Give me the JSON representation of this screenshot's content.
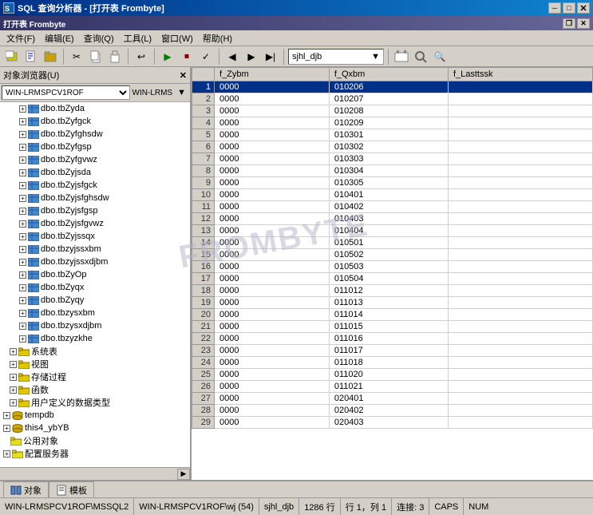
{
  "window": {
    "title": "SQL 查询分析器 - [打开表  Frombyte]",
    "icon": "SQL"
  },
  "titlebar": {
    "title": "SQL 查询分析器 - [打开表  Frombyte]",
    "minimize": "─",
    "maximize": "□",
    "restore": "❐",
    "close": "✕",
    "inner_restore": "❐",
    "inner_close": "✕"
  },
  "menubar": {
    "items": [
      {
        "label": "文件(F)"
      },
      {
        "label": "编辑(E)"
      },
      {
        "label": "查询(Q)"
      },
      {
        "label": "工具(L)"
      },
      {
        "label": "窗口(W)"
      },
      {
        "label": "帮助(H)"
      }
    ]
  },
  "toolbar": {
    "dropdown_value": "sjhl_djb",
    "buttons": [
      "⬅",
      "➡",
      "⊠",
      "📋",
      "✂",
      "📄",
      "📑",
      "⏸",
      "▶",
      "⏹",
      "⏸",
      "◀",
      "▶",
      "▶▶",
      "⏸"
    ]
  },
  "object_browser": {
    "header": "对象浏览器(U)",
    "server": "WIN-LRMSPCV1ROF",
    "connect_label": "WIN-LRMS",
    "tree_items": [
      {
        "indent": 20,
        "has_expand": true,
        "icon": "table",
        "label": "dbo.tbZyda",
        "level": 2
      },
      {
        "indent": 20,
        "has_expand": true,
        "icon": "table",
        "label": "dbo.tbZyfgck",
        "level": 2
      },
      {
        "indent": 20,
        "has_expand": true,
        "icon": "table",
        "label": "dbo.tbZyfghsdw",
        "level": 2
      },
      {
        "indent": 20,
        "has_expand": true,
        "icon": "table",
        "label": "dbo.tbZyfgsp",
        "level": 2
      },
      {
        "indent": 20,
        "has_expand": true,
        "icon": "table",
        "label": "dbo.tbZyfgvwz",
        "level": 2
      },
      {
        "indent": 20,
        "has_expand": true,
        "icon": "table",
        "label": "dbo.tbZyjsda",
        "level": 2
      },
      {
        "indent": 20,
        "has_expand": true,
        "icon": "table",
        "label": "dbo.tbZyjsfgck",
        "level": 2
      },
      {
        "indent": 20,
        "has_expand": true,
        "icon": "table",
        "label": "dbo.tbZyjsfghsdw",
        "level": 2
      },
      {
        "indent": 20,
        "has_expand": true,
        "icon": "table",
        "label": "dbo.tbZyjsfgsp",
        "level": 2
      },
      {
        "indent": 20,
        "has_expand": true,
        "icon": "table",
        "label": "dbo.tbZyjsfgvwz",
        "level": 2
      },
      {
        "indent": 20,
        "has_expand": true,
        "icon": "table",
        "label": "dbo.tbZyjssqx",
        "level": 2
      },
      {
        "indent": 20,
        "has_expand": true,
        "icon": "table",
        "label": "dbo.tbzyjssxbm",
        "level": 2
      },
      {
        "indent": 20,
        "has_expand": true,
        "icon": "table",
        "label": "dbo.tbzyjssxdjbm",
        "level": 2
      },
      {
        "indent": 20,
        "has_expand": true,
        "icon": "table",
        "label": "dbo.tbZyOp",
        "level": 2
      },
      {
        "indent": 20,
        "has_expand": true,
        "icon": "table",
        "label": "dbo.tbZyqx",
        "level": 2
      },
      {
        "indent": 20,
        "has_expand": true,
        "icon": "table",
        "label": "dbo.tbZyqy",
        "level": 2
      },
      {
        "indent": 20,
        "has_expand": true,
        "icon": "table",
        "label": "dbo.tbzysxbm",
        "level": 2
      },
      {
        "indent": 20,
        "has_expand": true,
        "icon": "table",
        "label": "dbo.tbzysxdjbm",
        "level": 2
      },
      {
        "indent": 20,
        "has_expand": true,
        "icon": "table",
        "label": "dbo.tbzyzkhe",
        "level": 2
      },
      {
        "indent": 8,
        "has_expand": true,
        "icon": "folder",
        "label": "系统表",
        "level": 1
      },
      {
        "indent": 8,
        "has_expand": true,
        "icon": "folder",
        "label": "视图",
        "level": 1
      },
      {
        "indent": 8,
        "has_expand": true,
        "icon": "folder",
        "label": "存储过程",
        "level": 1
      },
      {
        "indent": 8,
        "has_expand": true,
        "icon": "folder",
        "label": "函数",
        "level": 1
      },
      {
        "indent": 8,
        "has_expand": true,
        "icon": "folder",
        "label": "用户定义的数据类型",
        "level": 1
      },
      {
        "indent": 0,
        "has_expand": true,
        "icon": "database",
        "label": "tempdb",
        "level": 0
      },
      {
        "indent": 0,
        "has_expand": true,
        "icon": "database",
        "label": "this4_ybYB",
        "level": 0
      },
      {
        "indent": 0,
        "has_expand": false,
        "icon": "folder",
        "label": "公用对象",
        "level": 0
      },
      {
        "indent": 0,
        "has_expand": true,
        "icon": "folder",
        "label": "配置服务器",
        "level": 0
      }
    ]
  },
  "grid": {
    "columns": [
      {
        "label": "f_Zybm"
      },
      {
        "label": "f_Qxbm"
      },
      {
        "label": "f_Lasttssk"
      }
    ],
    "rows": [
      {
        "num": 1,
        "selected": true,
        "f_Zybm": "0000",
        "f_Qxbm": "010206",
        "f_Lasttssk": ""
      },
      {
        "num": 2,
        "selected": false,
        "f_Zybm": "0000",
        "f_Qxbm": "010207",
        "f_Lasttssk": ""
      },
      {
        "num": 3,
        "selected": false,
        "f_Zybm": "0000",
        "f_Qxbm": "010208",
        "f_Lasttssk": ""
      },
      {
        "num": 4,
        "selected": false,
        "f_Zybm": "0000",
        "f_Qxbm": "010209",
        "f_Lasttssk": ""
      },
      {
        "num": 5,
        "selected": false,
        "f_Zybm": "0000",
        "f_Qxbm": "010301",
        "f_Lasttssk": ""
      },
      {
        "num": 6,
        "selected": false,
        "f_Zybm": "0000",
        "f_Qxbm": "010302",
        "f_Lasttssk": ""
      },
      {
        "num": 7,
        "selected": false,
        "f_Zybm": "0000",
        "f_Qxbm": "010303",
        "f_Lasttssk": ""
      },
      {
        "num": 8,
        "selected": false,
        "f_Zybm": "0000",
        "f_Qxbm": "010304",
        "f_Lasttssk": ""
      },
      {
        "num": 9,
        "selected": false,
        "f_Zybm": "0000",
        "f_Qxbm": "010305",
        "f_Lasttssk": ""
      },
      {
        "num": 10,
        "selected": false,
        "f_Zybm": "0000",
        "f_Qxbm": "010401",
        "f_Lasttssk": ""
      },
      {
        "num": 11,
        "selected": false,
        "f_Zybm": "0000",
        "f_Qxbm": "010402",
        "f_Lasttssk": ""
      },
      {
        "num": 12,
        "selected": false,
        "f_Zybm": "0000",
        "f_Qxbm": "010403",
        "f_Lasttssk": ""
      },
      {
        "num": 13,
        "selected": false,
        "f_Zybm": "0000",
        "f_Qxbm": "010404",
        "f_Lasttssk": ""
      },
      {
        "num": 14,
        "selected": false,
        "f_Zybm": "0000",
        "f_Qxbm": "010501",
        "f_Lasttssk": ""
      },
      {
        "num": 15,
        "selected": false,
        "f_Zybm": "0000",
        "f_Qxbm": "010502",
        "f_Lasttssk": ""
      },
      {
        "num": 16,
        "selected": false,
        "f_Zybm": "0000",
        "f_Qxbm": "010503",
        "f_Lasttssk": ""
      },
      {
        "num": 17,
        "selected": false,
        "f_Zybm": "0000",
        "f_Qxbm": "010504",
        "f_Lasttssk": ""
      },
      {
        "num": 18,
        "selected": false,
        "f_Zybm": "0000",
        "f_Qxbm": "011012",
        "f_Lasttssk": ""
      },
      {
        "num": 19,
        "selected": false,
        "f_Zybm": "0000",
        "f_Qxbm": "011013",
        "f_Lasttssk": ""
      },
      {
        "num": 20,
        "selected": false,
        "f_Zybm": "0000",
        "f_Qxbm": "011014",
        "f_Lasttssk": ""
      },
      {
        "num": 21,
        "selected": false,
        "f_Zybm": "0000",
        "f_Qxbm": "011015",
        "f_Lasttssk": ""
      },
      {
        "num": 22,
        "selected": false,
        "f_Zybm": "0000",
        "f_Qxbm": "011016",
        "f_Lasttssk": ""
      },
      {
        "num": 23,
        "selected": false,
        "f_Zybm": "0000",
        "f_Qxbm": "011017",
        "f_Lasttssk": ""
      },
      {
        "num": 24,
        "selected": false,
        "f_Zybm": "0000",
        "f_Qxbm": "011018",
        "f_Lasttssk": ""
      },
      {
        "num": 25,
        "selected": false,
        "f_Zybm": "0000",
        "f_Qxbm": "011020",
        "f_Lasttssk": ""
      },
      {
        "num": 26,
        "selected": false,
        "f_Zybm": "0000",
        "f_Qxbm": "011021",
        "f_Lasttssk": ""
      },
      {
        "num": 27,
        "selected": false,
        "f_Zybm": "0000",
        "f_Qxbm": "020401",
        "f_Lasttssk": ""
      },
      {
        "num": 28,
        "selected": false,
        "f_Zybm": "0000",
        "f_Qxbm": "020402",
        "f_Lasttssk": ""
      },
      {
        "num": 29,
        "selected": false,
        "f_Zybm": "0000",
        "f_Qxbm": "020403",
        "f_Lasttssk": ""
      }
    ]
  },
  "bottom_tabs": [
    {
      "icon": "object-icon",
      "label": "对象"
    },
    {
      "icon": "template-icon",
      "label": "模板"
    }
  ],
  "statusbar": {
    "path": "WIN-LRMSPCV1ROF\\MSSQL2",
    "context": "WIN-LRMSPCV1ROF\\wj (54)",
    "database": "sjhl_djb",
    "row_count": "1286 行",
    "position": "行 1，列 1",
    "connection": "连接: 3",
    "caps": "CAPS",
    "num": "NUM"
  }
}
